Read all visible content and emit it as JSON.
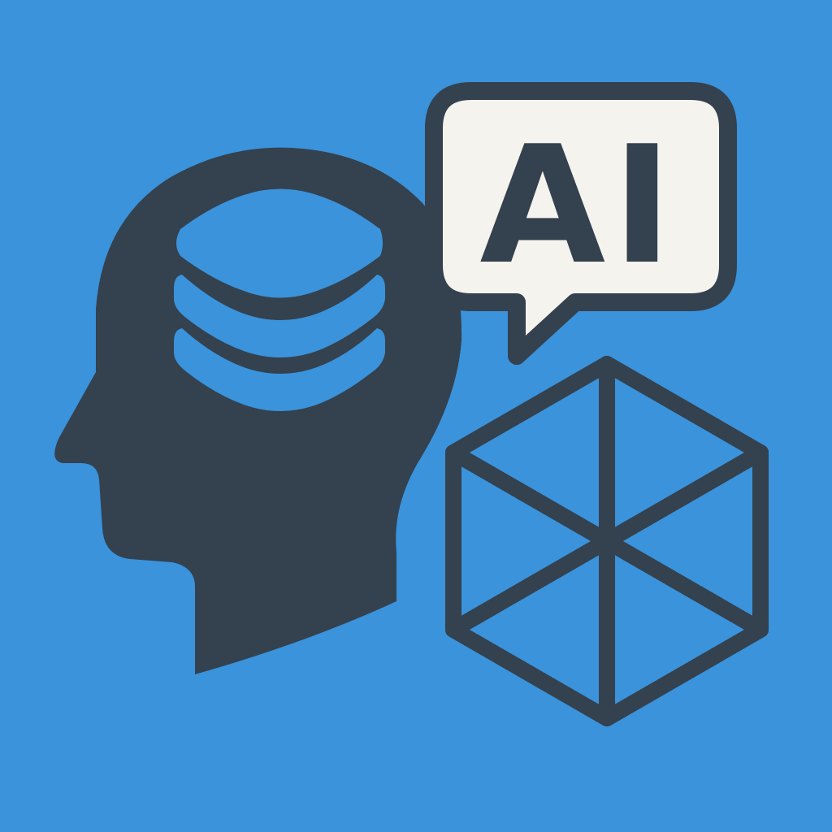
{
  "colors": {
    "background": "#3a93db",
    "ink": "#34414e",
    "bubble_fill": "#f5f3ee"
  },
  "icons": {
    "head": "head-silhouette-icon",
    "layers": "layers-stack-icon",
    "bubble": "speech-bubble-icon",
    "cube": "wireframe-cube-icon"
  },
  "bubble": {
    "text": "AI"
  }
}
